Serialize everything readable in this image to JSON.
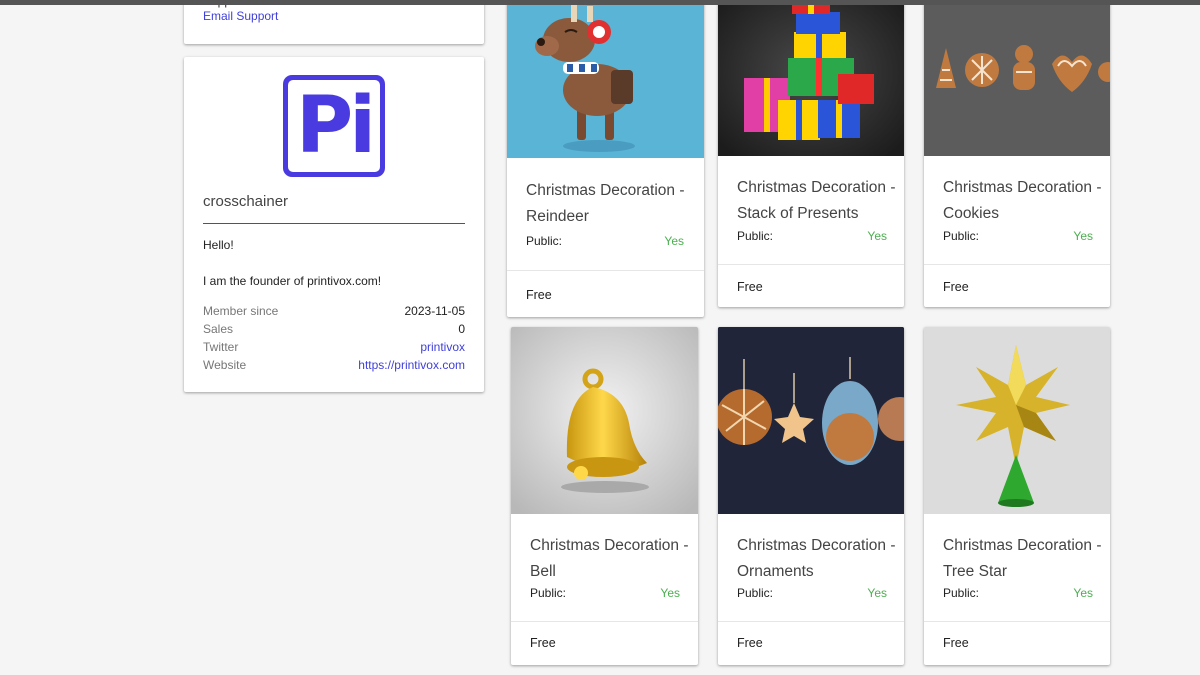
{
  "support": {
    "title": "Support",
    "email_link": "Email Support"
  },
  "profile": {
    "logo_text": "Pi",
    "username": "crosschainer",
    "bio_line1": "Hello!",
    "bio_line2": "I am the founder of printivox.com!",
    "member_since_label": "Member since",
    "member_since_value": "2023-11-05",
    "sales_label": "Sales",
    "sales_value": "0",
    "twitter_label": "Twitter",
    "twitter_value": "printivox",
    "website_label": "Website",
    "website_value": "https://printivox.com"
  },
  "products": [
    {
      "title": "Christmas Decoration - Reindeer",
      "image": "reindeer-image",
      "public_label": "Public:",
      "public_value": "Yes",
      "price": "Free"
    },
    {
      "title": "Christmas Decoration - Stack of Presents",
      "image": "presents-image",
      "public_label": "Public:",
      "public_value": "Yes",
      "price": "Free"
    },
    {
      "title": "Christmas Decoration - Cookies",
      "image": "cookies-image",
      "public_label": "Public:",
      "public_value": "Yes",
      "price": "Free"
    },
    {
      "title": "Christmas Decoration - Bell",
      "image": "bell-image",
      "public_label": "Public:",
      "public_value": "Yes",
      "price": "Free"
    },
    {
      "title": "Christmas Decoration - Ornaments",
      "image": "ornaments-image",
      "public_label": "Public:",
      "public_value": "Yes",
      "price": "Free"
    },
    {
      "title": "Christmas Decoration - Tree Star",
      "image": "tree-star-image",
      "public_label": "Public:",
      "public_value": "Yes",
      "price": "Free"
    }
  ],
  "colors": {
    "accent_link": "#3f3fd9",
    "logo_brand": "#4a3be0",
    "public_yes": "#4caf50",
    "page_background": "#f5f5f5"
  }
}
